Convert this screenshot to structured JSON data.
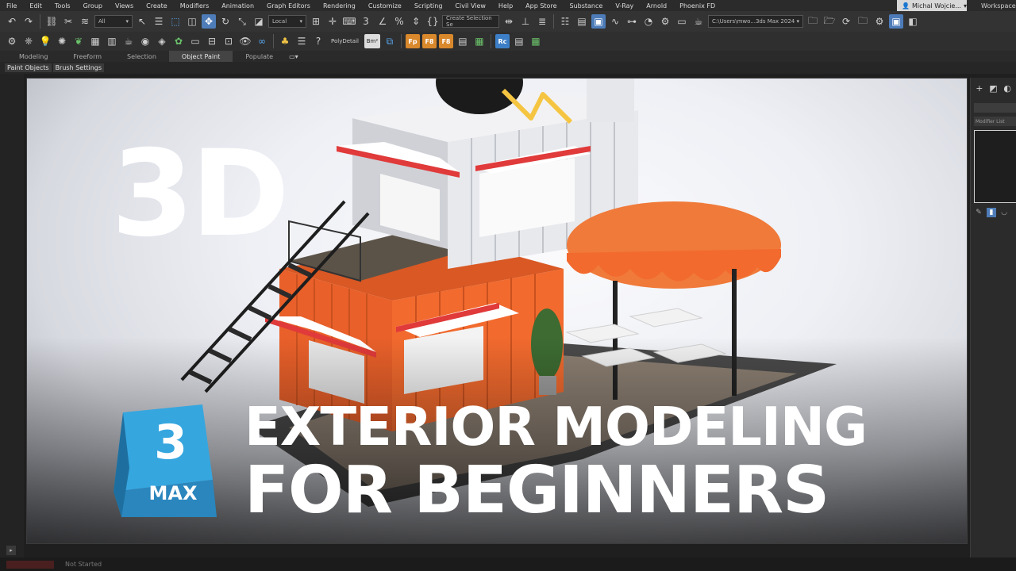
{
  "menu": {
    "items": [
      "File",
      "Edit",
      "Tools",
      "Group",
      "Views",
      "Create",
      "Modifiers",
      "Animation",
      "Graph Editors",
      "Rendering",
      "Customize",
      "Scripting",
      "Civil View",
      "Help",
      "App Store",
      "Substance",
      "V-Ray",
      "Arnold",
      "Phoenix FD"
    ],
    "user": "Michal Wojcie...",
    "workspaces": "Workspaces"
  },
  "toolbar": {
    "filter_value": "All",
    "coord_value": "Local",
    "selection_set_placeholder": "Create Selection Se",
    "path_value": "C:\\Users\\mwo...3ds Max 2024",
    "polydetail_label": "PolyDetail",
    "bm_label": "Bm²",
    "rc_label": "Rc",
    "fp_labels": [
      "Fp",
      "F8",
      "F8"
    ]
  },
  "ribbon": {
    "tabs": [
      "Modeling",
      "Freeform",
      "Selection",
      "Object Paint",
      "Populate"
    ],
    "active_tab": "Object Paint",
    "sub_buttons": [
      "Paint Objects",
      "Brush Settings"
    ]
  },
  "command_panel": {
    "modifier_list_label": "Modifier List"
  },
  "status": {
    "text": "Not Started"
  },
  "thumbnail": {
    "badge": "3D",
    "headline_line1": "EXTERIOR MODELING",
    "headline_line2": "FOR BEGINNERS",
    "logo_number": "3",
    "logo_word": "MAX"
  },
  "colors": {
    "container_orange": "#f26a2e",
    "awning_red": "#e03a3a",
    "logo_blue": "#2f8fc9",
    "neon_gold": "#f5c542",
    "highlight_blue": "#4d7cb8"
  }
}
